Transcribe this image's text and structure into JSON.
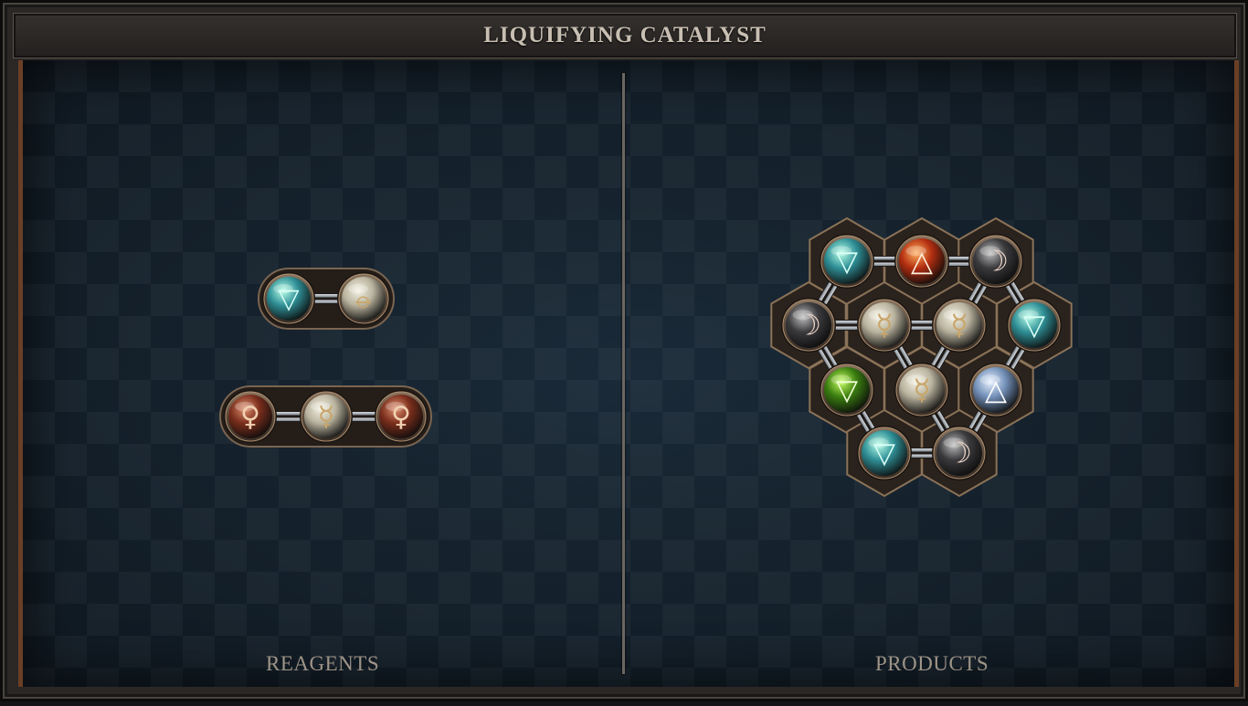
{
  "title": "LIQUIFYING CATALYST",
  "reagents_label": "REAGENTS",
  "products_label": "PRODUCTS",
  "elements": {
    "water": {
      "glyph": "▽",
      "color": "#2f8f96",
      "highlight": "#b8ffe8",
      "glyph_color": "#d8fff6"
    },
    "fire": {
      "glyph": "△",
      "color": "#b32e10",
      "highlight": "#ffb060",
      "glyph_color": "#fff0dc"
    },
    "air": {
      "glyph": "△",
      "color": "#7390b8",
      "highlight": "#e8f2ff",
      "glyph_color": "#ffffff"
    },
    "earth": {
      "glyph": "▽",
      "color": "#3a7d10",
      "highlight": "#c8ff60",
      "glyph_color": "#f0ffd8"
    },
    "salt": {
      "glyph": "⦵",
      "color": "#b9b39e",
      "highlight": "#f5f2e4",
      "glyph_color": "#c9a66b"
    },
    "quicksilver": {
      "glyph": "☿",
      "color": "#b9b39e",
      "highlight": "#f5f2e4",
      "glyph_color": "#c9a66b"
    },
    "vitae": {
      "glyph": "☽",
      "color": "#3a3a3d",
      "highlight": "#bfbfbf",
      "glyph_color": "#f0d6c8"
    },
    "copper": {
      "glyph": "♀",
      "color": "#7a2e1c",
      "highlight": "#e09070",
      "glyph_color": "#f0d0b0"
    }
  },
  "reagents": [
    {
      "name": "water-salt",
      "atoms": [
        "water",
        "salt"
      ]
    },
    {
      "name": "copper-chain",
      "atoms": [
        "copper",
        "quicksilver",
        "copper"
      ]
    }
  ],
  "products": [
    {
      "name": "hex-molecule",
      "atoms": [
        "water",
        "fire",
        "vitae",
        "vitae",
        "quicksilver",
        "quicksilver",
        "water",
        "earth",
        "quicksilver",
        "air",
        "water",
        "vitae"
      ]
    }
  ]
}
